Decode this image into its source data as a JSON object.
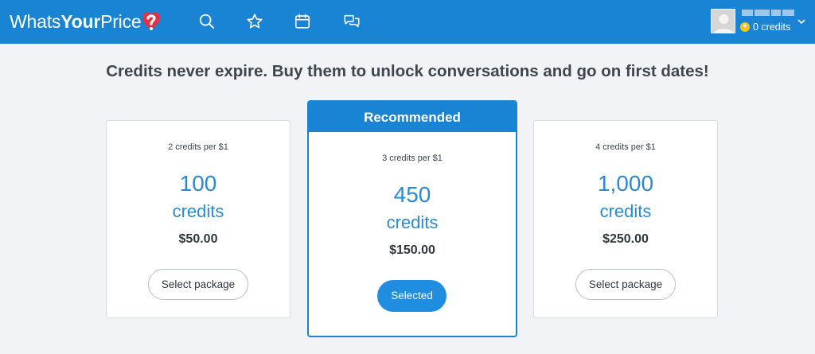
{
  "header": {
    "logo_light": "Whats",
    "logo_bold": "Your",
    "logo_light2": "Price",
    "nav": [
      "search-icon",
      "star-icon",
      "calendar-icon",
      "chat-icon"
    ],
    "credits_label": "0 credits",
    "accent": "#1a84d4"
  },
  "headline": "Credits never expire. Buy them to unlock conversations and go on first dates!",
  "packages": [
    {
      "rate": "2 credits per $1",
      "amount": "100",
      "unit": "credits",
      "price": "$50.00",
      "button": "Select package"
    },
    {
      "badge": "Recommended",
      "rate": "3 credits per $1",
      "amount": "450",
      "unit": "credits",
      "price": "$150.00",
      "button": "Selected"
    },
    {
      "rate": "4 credits per $1",
      "amount": "1,000",
      "unit": "credits",
      "price": "$250.00",
      "button": "Select package"
    }
  ]
}
